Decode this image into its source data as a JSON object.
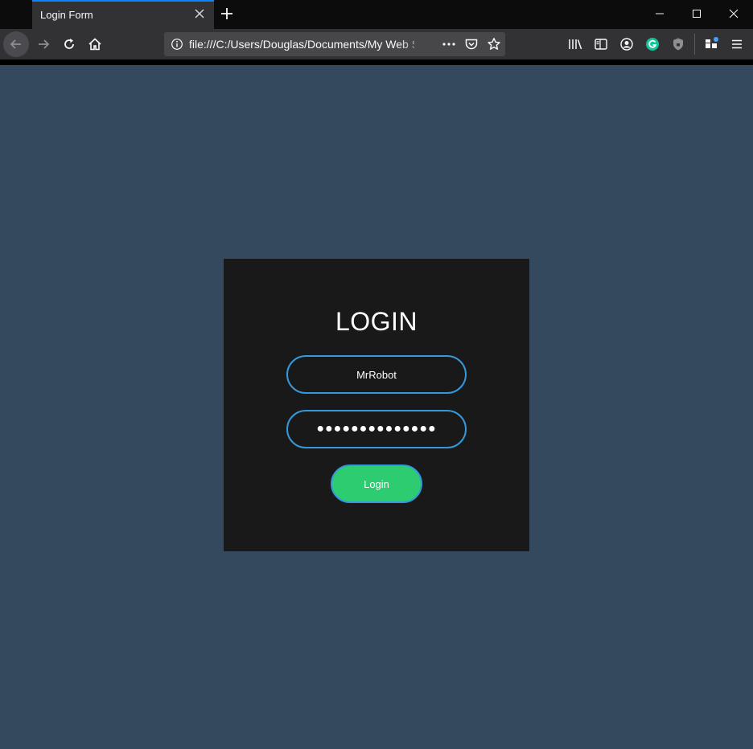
{
  "browser": {
    "tab": {
      "title": "Login Form"
    },
    "url": "file:///C:/Users/Douglas/Documents/My Web Sites/Login Form/index.html",
    "url_display": "file:///C:/Users/Douglas/Documents/My Web S",
    "icons": [
      "back-icon",
      "forward-icon",
      "reload-icon",
      "home-icon",
      "info-icon",
      "more-icon",
      "pocket-icon",
      "star-icon",
      "library-icon",
      "sidebar-icon",
      "account-icon",
      "grammarly-icon",
      "shield-icon",
      "extensions-icon",
      "menu-icon"
    ],
    "colors": {
      "tab_accent": "#0a84ff",
      "grammarly": "#15c39a",
      "notify_dot": "#45a1ff"
    }
  },
  "page": {
    "background": "#34495e",
    "card_background": "#191919",
    "title": "LOGIN",
    "username_value": "MrRobot",
    "password_mask": "●●●●●●●●●●●●●●",
    "login_label": "Login",
    "colors": {
      "field_border": "#3498db",
      "button": "#2ecc71"
    }
  }
}
